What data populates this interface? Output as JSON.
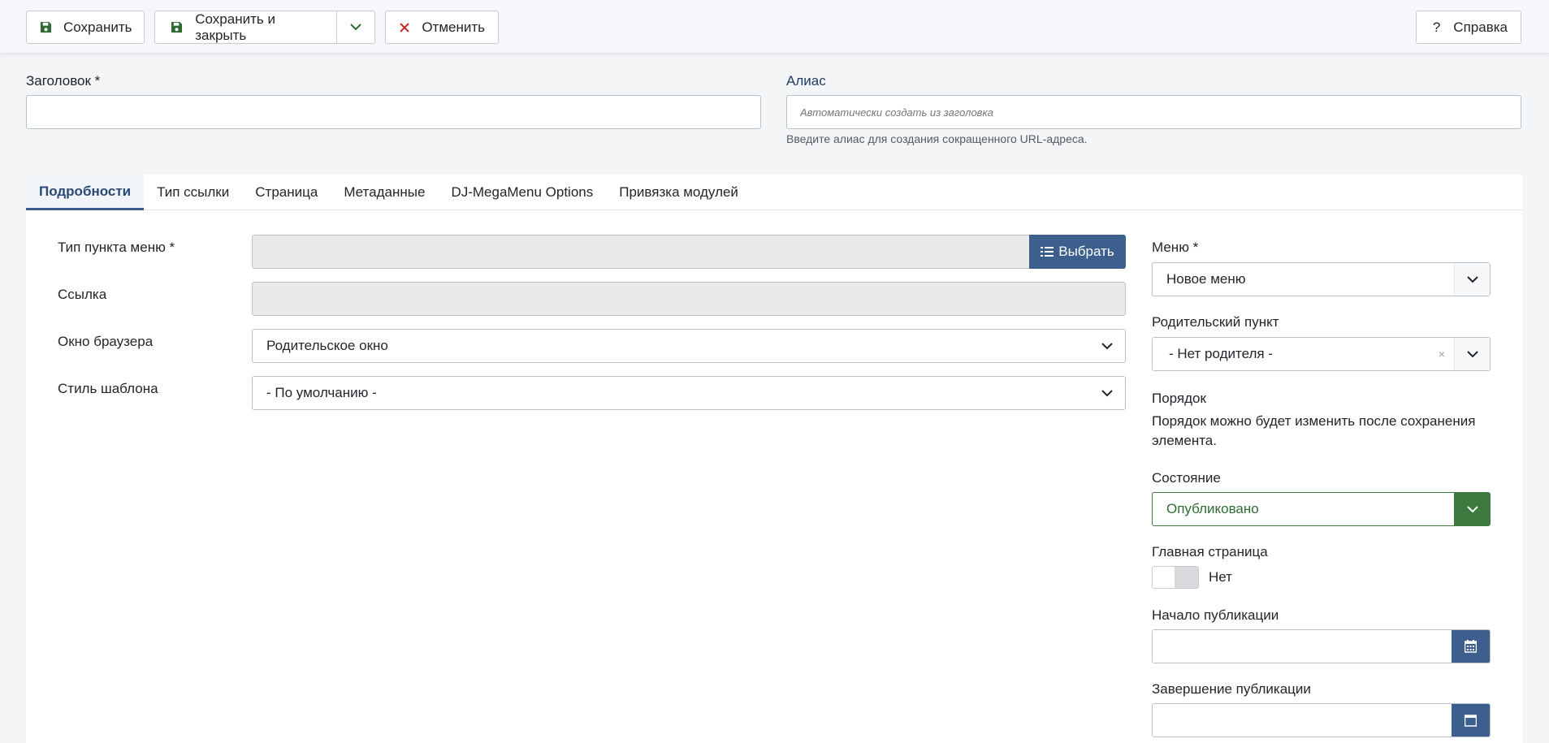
{
  "toolbar": {
    "save_label": "Сохранить",
    "save_close_label": "Сохранить и закрыть",
    "cancel_label": "Отменить",
    "help_label": "Справка"
  },
  "form": {
    "title_label": "Заголовок *",
    "title_value": "",
    "alias_label": "Алиас",
    "alias_placeholder": "Автоматически создать из заголовка",
    "alias_hint": "Введите алиас для создания сокращенного URL-адреса."
  },
  "tabs": [
    {
      "label": "Подробности",
      "active": true
    },
    {
      "label": "Тип ссылки"
    },
    {
      "label": "Страница"
    },
    {
      "label": "Метаданные"
    },
    {
      "label": "DJ-MegaMenu Options"
    },
    {
      "label": "Привязка модулей"
    }
  ],
  "details": {
    "menu_item_type_label": "Тип пункта меню *",
    "select_button_label": "Выбрать",
    "link_label": "Ссылка",
    "browser_window_label": "Окно браузера",
    "browser_window_value": "Родительское окно",
    "template_style_label": "Стиль шаблона",
    "template_style_value": "- По умолчанию -"
  },
  "sidebar": {
    "menu_label": "Меню *",
    "menu_value": "Новое меню",
    "parent_label": "Родительский пункт",
    "parent_value": "- Нет родителя -",
    "order_label": "Порядок",
    "order_text": "Порядок можно будет изменить после сохранения элемента.",
    "state_label": "Состояние",
    "state_value": "Опубликовано",
    "home_label": "Главная страница",
    "home_value": "Нет",
    "publish_up_label": "Начало публикации",
    "publish_down_label": "Завершение публикации"
  },
  "colors": {
    "primary": "#3c5f8e",
    "success": "#3e7a3f",
    "danger": "#c92a2a"
  }
}
